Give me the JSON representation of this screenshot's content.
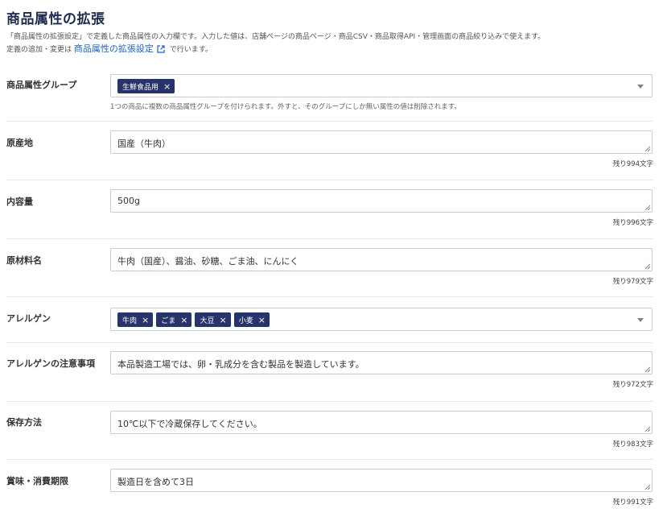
{
  "page": {
    "title": "商品属性の拡張",
    "desc_line1": "「商品属性の拡張設定」で定義した商品属性の入力欄です。入力した値は、店舗ページの商品ページ・商品CSV・商品取得API・管理画面の商品絞り込みで使えます。",
    "desc_line2_prefix": "定義の追加・変更は",
    "desc_link": "商品属性の拡張設定",
    "desc_line2_suffix": "で行います。"
  },
  "fields": {
    "group": {
      "label": "商品属性グループ",
      "chips": [
        "生鮮食品用"
      ],
      "hint": "1つの商品に複数の商品属性グループを付けられます。外すと、そのグループにしか無い属性の値は削除されます。"
    },
    "origin": {
      "label": "原産地",
      "value": "国産（牛肉）",
      "remaining": "残り994文字"
    },
    "volume": {
      "label": "内容量",
      "value": "500g",
      "remaining": "残り996文字"
    },
    "ingredients": {
      "label": "原材料名",
      "value": "牛肉（国産）、醤油、砂糖、ごま油、にんにく",
      "remaining": "残り979文字"
    },
    "allergen": {
      "label": "アレルゲン",
      "chips": [
        "牛肉",
        "ごま",
        "大豆",
        "小麦"
      ]
    },
    "allergen_note": {
      "label": "アレルゲンの注意事項",
      "value": "本品製造工場では、卵・乳成分を含む製品を製造しています。",
      "remaining": "残り972文字"
    },
    "storage": {
      "label": "保存方法",
      "value": "10℃以下で冷蔵保存してください。",
      "remaining": "残り983文字"
    },
    "expiry": {
      "label": "賞味・消費期限",
      "value": "製造日を含めて3日",
      "remaining": "残り991文字"
    }
  },
  "ui": {
    "chip_remove_glyph": "×",
    "icons": [
      "external-link-icon",
      "chevron-down-icon",
      "close-icon",
      "resize-grip-icon"
    ]
  }
}
